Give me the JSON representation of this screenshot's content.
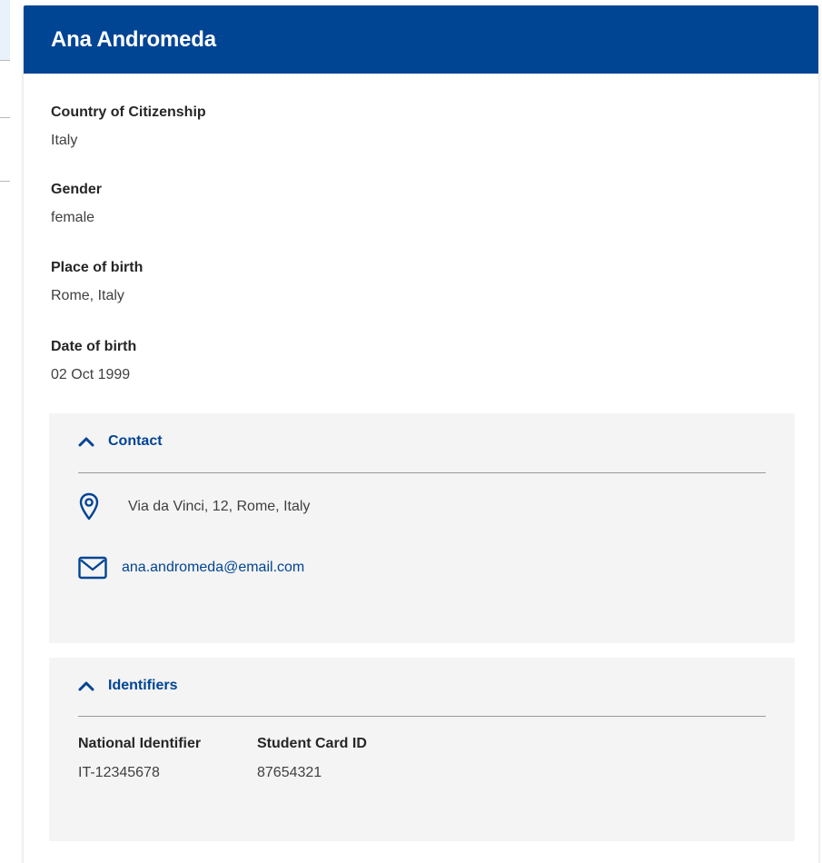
{
  "profile": {
    "name": "Ana Andromeda"
  },
  "fields": [
    {
      "label": "Country of Citizenship",
      "value": "Italy"
    },
    {
      "label": "Gender",
      "value": "female"
    },
    {
      "label": "Place of birth",
      "value": "Rome, Italy"
    },
    {
      "label": "Date of birth",
      "value": "02 Oct 1999"
    }
  ],
  "contact": {
    "title": "Contact",
    "expanded": true,
    "address": "Via da Vinci, 12, Rome, Italy",
    "address_icon": "location-pin-icon",
    "email": "ana.andromeda@email.com",
    "email_icon": "envelope-icon"
  },
  "identifiers": {
    "title": "Identifiers",
    "expanded": true,
    "items": [
      {
        "label": "National Identifier",
        "value": "IT-12345678"
      },
      {
        "label": "Student Card ID",
        "value": "87654321"
      }
    ]
  },
  "colors": {
    "primary": "#004494",
    "section_bg": "#f4f4f4",
    "text": "#404040"
  }
}
